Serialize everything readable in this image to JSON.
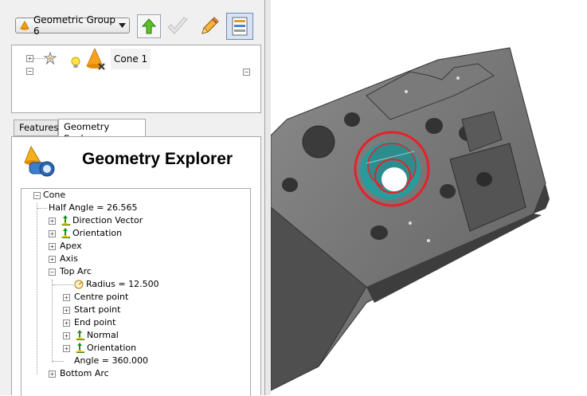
{
  "toolbar": {
    "group_select": {
      "value": "Geometric Group 6"
    },
    "buttons": [
      {
        "name": "up-button",
        "icon": "green-up-arrow-icon"
      },
      {
        "name": "checkmark-button",
        "icon": "checkmark-icon"
      },
      {
        "name": "edit-button",
        "icon": "pencil-icon"
      },
      {
        "name": "properties-button",
        "icon": "properties-panel-icon",
        "pressed": true
      }
    ]
  },
  "top_tree": {
    "item_label": "Cone 1",
    "icons": [
      "burst-icon",
      "lightbulb-icon",
      "cone-icon"
    ]
  },
  "tabs": [
    {
      "label": "Features",
      "active": false
    },
    {
      "label": "Geometry Explorer",
      "active": true
    }
  ],
  "geometry_explorer": {
    "title": "Geometry Explorer",
    "tree": [
      {
        "label": "Cone"
      },
      {
        "label": "Half Angle = 26.565"
      },
      {
        "label": "Direction Vector"
      },
      {
        "label": "Orientation"
      },
      {
        "label": "Apex"
      },
      {
        "label": "Axis"
      },
      {
        "label": "Top Arc"
      },
      {
        "label": "Radius = 12.500"
      },
      {
        "label": "Centre point"
      },
      {
        "label": "Start point"
      },
      {
        "label": "End point"
      },
      {
        "label": "Normal"
      },
      {
        "label": "Orientation"
      },
      {
        "label": "Angle = 360.000"
      },
      {
        "label": "Bottom Arc"
      }
    ]
  },
  "colors": {
    "highlight_ring": "#e8202a",
    "selected_face": "#2a9a9a",
    "part_gray": "#6f6f6f"
  }
}
